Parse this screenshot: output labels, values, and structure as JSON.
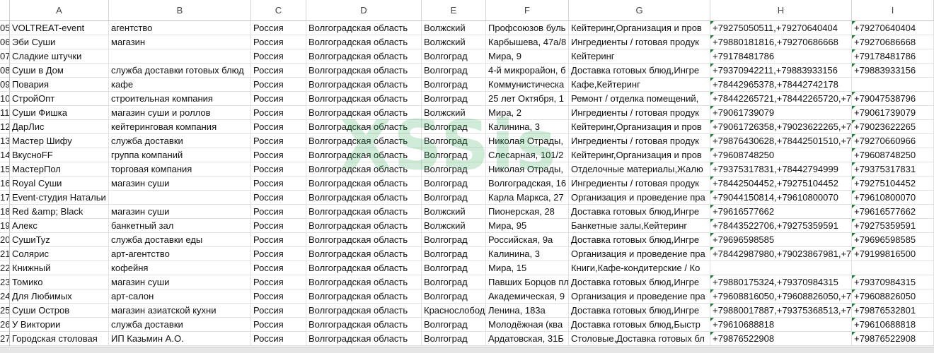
{
  "columns": [
    "A",
    "B",
    "C",
    "D",
    "E",
    "F",
    "G",
    "H",
    "I"
  ],
  "watermark": "XSSis",
  "rows": [
    {
      "rn": "05",
      "c": [
        "VOLTREAT-event",
        "агентство",
        "Россия",
        "Волгоградская область",
        "Волжский",
        "Профсоюзов буль",
        "Кейтеринг,Организация и пров",
        "+79275050511,+79270640404",
        "+79270640404"
      ]
    },
    {
      "rn": "06",
      "c": [
        "Эби Суши",
        "магазин",
        "Россия",
        "Волгоградская область",
        "Волжский",
        "Карбышева, 47а/8",
        "Ингредиенты / готовая продук",
        "+79880181816,+79270686668",
        "+79270686668"
      ]
    },
    {
      "rn": "07",
      "c": [
        "Сладкие штучки",
        "",
        "Россия",
        "Волгоградская область",
        "Волгоград",
        "Мира, 9",
        "Кейтеринг",
        "+79178481786",
        "+79178481786"
      ]
    },
    {
      "rn": "08",
      "c": [
        "Суши в Дом",
        "служба доставки готовых блюд",
        "Россия",
        "Волгоградская область",
        "Волгоград",
        "4-й микрорайон, б",
        "Доставка готовых блюд,Ингре",
        "+79370942211,+79883933156",
        "+79883933156"
      ]
    },
    {
      "rn": "09",
      "c": [
        "Повария",
        "кафе",
        "Россия",
        "Волгоградская область",
        "Волгоград",
        "Коммунистическа",
        "Кафе,Кейтеринг",
        "+78442965378,+78442742178",
        ""
      ]
    },
    {
      "rn": "10",
      "c": [
        "СтройОпт",
        "строительная компания",
        "Россия",
        "Волгоградская область",
        "Волгоград",
        "25 лет Октября, 1",
        "Ремонт / отделка помещений,",
        "+78442265721,+78442265720,+79",
        "+79047538796"
      ]
    },
    {
      "rn": "11",
      "c": [
        "Суши Фишка",
        "магазин суши и роллов",
        "Россия",
        "Волгоградская область",
        "Волжский",
        "Мира, 2",
        "Ингредиенты / готовая продук",
        "+79061739079",
        "+79061739079"
      ]
    },
    {
      "rn": "12",
      "c": [
        "ДарЛис",
        "кейтеринговая компания",
        "Россия",
        "Волгоградская область",
        "Волгоград",
        "Калинина, 3",
        "Кейтеринг,Организация и пров",
        "+79061726358,+79023622265,+78",
        "+79023622265"
      ]
    },
    {
      "rn": "13",
      "c": [
        "Мастер Шифу",
        "служба доставки",
        "Россия",
        "Волгоградская область",
        "Волгоград",
        "Николая Отрады,",
        "Ингредиенты / готовая продук",
        "+79876430628,+78442501510,+79",
        "+79270660966"
      ]
    },
    {
      "rn": "14",
      "c": [
        "ВкусноFF",
        "группа компаний",
        "Россия",
        "Волгоградская область",
        "Волгоград",
        "Слесарная, 101/2",
        "Кейтеринг,Организация и пров",
        "+79608748250",
        "+79608748250"
      ]
    },
    {
      "rn": "15",
      "c": [
        "МастерПол",
        "торговая компания",
        "Россия",
        "Волгоградская область",
        "Волгоград",
        "Николая Отрады,",
        "Отделочные материалы,Жалю",
        "+79375317831,+78442794999",
        "+79375317831"
      ]
    },
    {
      "rn": "16",
      "c": [
        "Royal Суши",
        "магазин суши",
        "Россия",
        "Волгоградская область",
        "Волгоград",
        "Волгоградская, 16",
        "Ингредиенты / готовая продук",
        "+78442504452,+79275104452",
        "+79275104452"
      ]
    },
    {
      "rn": "17",
      "c": [
        "Event-студия Натальи",
        "",
        "Россия",
        "Волгоградская область",
        "Волгоград",
        "Карла Маркса, 27",
        "Организация и проведение пра",
        "+79044150814,+79610800070",
        "+79610800070"
      ]
    },
    {
      "rn": "18",
      "c": [
        "Red &amp; Black",
        "магазин суши",
        "Россия",
        "Волгоградская область",
        "Волжский",
        "Пионерская, 28",
        "Доставка готовых блюд,Ингре",
        "+79616577662",
        "+79616577662"
      ]
    },
    {
      "rn": "19",
      "c": [
        "Алекс",
        "банкетный зал",
        "Россия",
        "Волгоградская область",
        "Волжский",
        "Мира, 95",
        "Банкетные залы,Кейтеринг",
        "+78443522706,+79275359591",
        "+79275359591"
      ]
    },
    {
      "rn": "20",
      "c": [
        "СушиТуz",
        "служба доставки еды",
        "Россия",
        "Волгоградская область",
        "Волгоград",
        "Российская, 9а",
        "Доставка готовых блюд,Ингре",
        "+79696598585",
        "+79696598585"
      ]
    },
    {
      "rn": "21",
      "c": [
        "Солярис",
        "арт-агентство",
        "Россия",
        "Волгоградская область",
        "Волгоград",
        "Калинина, 3",
        "Организация и проведение пра",
        "+78442987980,+79023867981,+79",
        "+79199816500"
      ]
    },
    {
      "rn": "22",
      "c": [
        "Книжный",
        "кофейня",
        "Россия",
        "Волгоградская область",
        "Волгоград",
        "Мира, 15",
        "Книги,Кафе-кондитерские / Ко",
        "",
        ""
      ]
    },
    {
      "rn": "23",
      "c": [
        "Томико",
        "магазин суши",
        "Россия",
        "Волгоградская область",
        "Волгоград",
        "Павших Борцов пл",
        "Доставка готовых блюд,Ингре",
        "+79880175324,+79370984315",
        "+79370984315"
      ]
    },
    {
      "rn": "24",
      "c": [
        "Для Любимых",
        "арт-салон",
        "Россия",
        "Волгоградская область",
        "Волгоград",
        "Академическая, 9",
        "Организация и проведение пра",
        "+79608816050,+79608826050,+78",
        "+79608826050"
      ]
    },
    {
      "rn": "25",
      "c": [
        "Суши Остров",
        "магазин азиатской кухни",
        "Россия",
        "Волгоградская область",
        "Краснослобод",
        "Ленина, 183а",
        "Доставка готовых блюд,Ингре",
        "+79880017887,+79375368513,+79",
        "+79876532801"
      ]
    },
    {
      "rn": "26",
      "c": [
        "У Виктории",
        "служба доставки",
        "Россия",
        "Волгоградская область",
        "Волгоград",
        "Молодёжная (ква",
        "Доставка готовых блюд,Быстр",
        "+79610688818",
        "+79610688818"
      ]
    },
    {
      "rn": "27",
      "c": [
        "Городская столовая",
        "ИП Казьмин А.О.",
        "Россия",
        "Волгоградская область",
        "Волгоград",
        "Ардатовская, 31Б",
        "Столовые,Доставка готовых бл",
        "+79876522908",
        "+79876522908"
      ]
    }
  ]
}
